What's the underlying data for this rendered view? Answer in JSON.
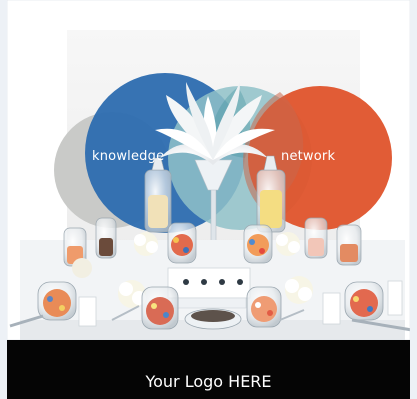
{
  "image": {
    "backdrop_words": {
      "left": "knowledge",
      "right": "network"
    },
    "logo_bar": {
      "text": "Your Logo HERE"
    },
    "colors": {
      "backdrop_blue": "#2f6db0",
      "backdrop_orange": "#e0552e",
      "backdrop_teal": "#8fc1c8",
      "backdrop_grey": "#c9cac8",
      "table_cloth": "#ffffff",
      "logo_bar": "#050505"
    }
  }
}
